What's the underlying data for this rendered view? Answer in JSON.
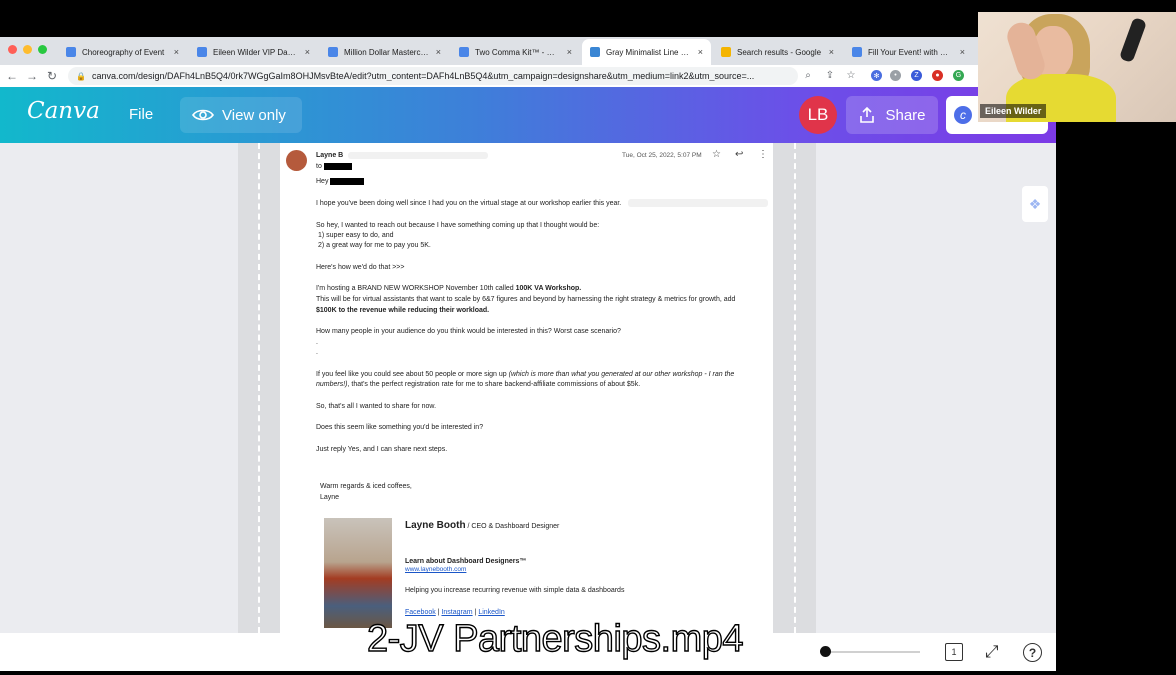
{
  "browser": {
    "tabs": [
      {
        "title": "Choreography of Event",
        "icon_color": "#4a86e8",
        "active": false
      },
      {
        "title": "Eileen Wilder VIP Day™",
        "icon_color": "#4a86e8",
        "active": false
      },
      {
        "title": "Million Dollar Masterclass",
        "icon_color": "#4a86e8",
        "active": false
      },
      {
        "title": "Two Comma Kit™ - Goo",
        "icon_color": "#4a86e8",
        "active": false
      },
      {
        "title": "Gray Minimalist Line Sin",
        "icon_color": "#3a86d4",
        "active": true
      },
      {
        "title": "Search results - Google",
        "icon_color": "#f4b400",
        "active": false
      },
      {
        "title": "Fill Your Event! with Gue",
        "icon_color": "#4a86e8",
        "active": false
      }
    ],
    "tab_close_glyph": "×",
    "url": "canva.com/design/DAFh4LnB5Q4/0rk7WGgGaIm8OHJMsvBteA/edit?utm_content=DAFh4LnB5Q4&utm_campaign=designshare&utm_medium=link2&utm_source=..."
  },
  "canva": {
    "logo": "Canva",
    "file_menu": "File",
    "view_only": "View only",
    "avatar_initials": "LB",
    "share": "Share"
  },
  "email": {
    "sender": "Layne B",
    "to_label": "to",
    "date": "Tue, Oct 25, 2022, 5:07 PM",
    "greeting": "Hey",
    "p1": "I hope you've been doing well since I had you on the virtual stage at our workshop earlier this year.",
    "p2": "So hey, I wanted to reach out because I have something coming up that I thought would be:",
    "p2_item1": "1) super easy to do, and",
    "p2_item2": "2) a great way for me to pay you 5K.",
    "p3": "Here's how we'd do that >>>",
    "p4_a": "I'm hosting a BRAND NEW WORKSHOP November 10th called ",
    "p4_bold": "100K VA Workshop.",
    "p4_line2": "This will be for virtual assistants that want to scale by 6&7 figures and beyond by harnessing the right strategy & metrics for growth, add",
    "p4_line3": "$100K to the revenue while reducing their workload.",
    "p5": "How many people in your audience do you think would be interested in this? Worst case scenario?",
    "dot": ".",
    "p6_a": "If you feel like you could see about 50 people or more sign up ",
    "p6_italic1": "(which is more than what you generated at our other workshop - I ran the",
    "p6_italic2": "numbers!)",
    "p6_b": ", that's the perfect registration rate for me to share backend-affiliate commissions of about $5k.",
    "p7": "So, that's all I wanted to share for now.",
    "p8": "Does this seem like something you'd be interested in?",
    "p9": "Just reply Yes, and I can share next steps.",
    "signoff1": "Warm regards & iced coffees,",
    "signoff2": "Layne",
    "sig_name": "Layne Booth",
    "sig_title": " / CEO & Dashboard Designer",
    "sig_learn": "Learn about Dashboard Designers™",
    "sig_website": "www.laynebooth.com",
    "sig_tagline": "Helping you increase recurring revenue with simple data & dashboards",
    "sig_facebook": "Facebook",
    "sig_sep": " | ",
    "sig_instagram": "Instagram",
    "sig_linkedin": "LinkedIn"
  },
  "footer": {
    "page_count": "1",
    "help": "?",
    "zoom_progress": 0.0
  },
  "video": {
    "caption": "2-JV Partnerships.mp4",
    "webcam_name": "Eileen Wilder"
  }
}
